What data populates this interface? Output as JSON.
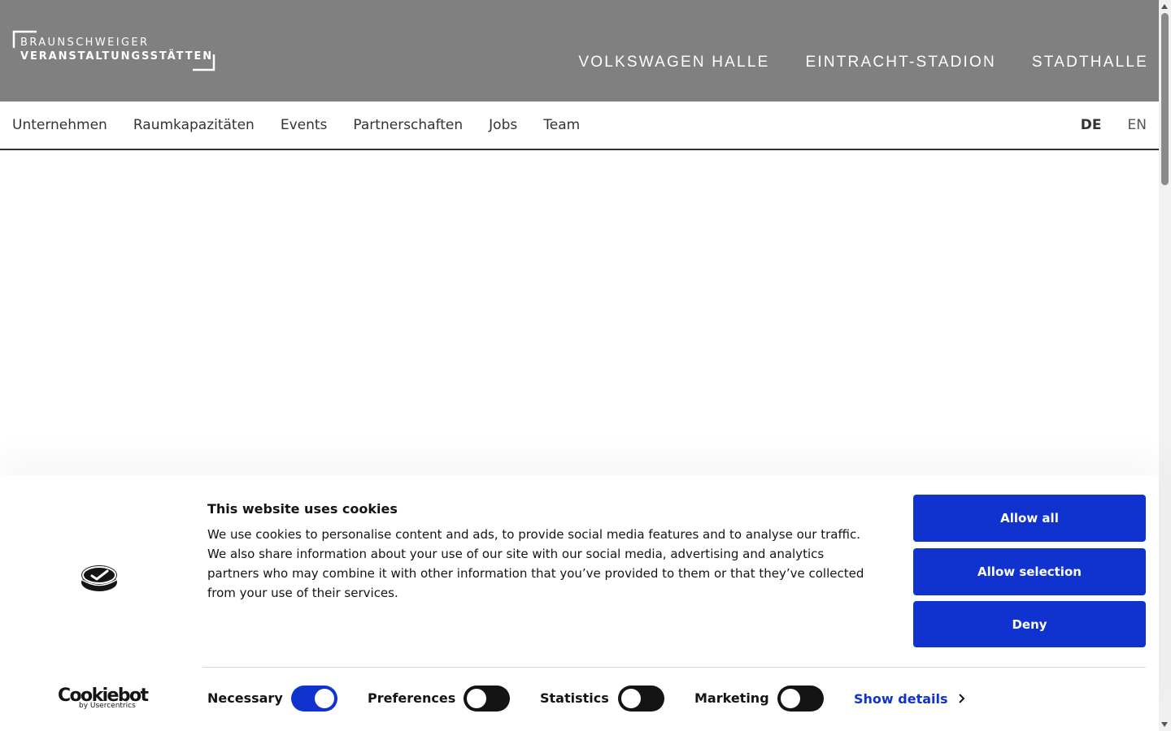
{
  "header": {
    "logo_line1": "BRAUNSCHWEIGER",
    "logo_line2": "VERANSTALTUNGSSTÄTTEN",
    "venues": [
      "VOLKSWAGEN HALLE",
      "EINTRACHT-STADION",
      "STADTHALLE"
    ],
    "background": "#808080"
  },
  "nav": {
    "items": [
      "Unternehmen",
      "Raumkapazitäten",
      "Events",
      "Partnerschaften",
      "Jobs",
      "Team"
    ],
    "languages": [
      "DE",
      "EN"
    ],
    "active_language": "DE"
  },
  "cookie_banner": {
    "title": "This website uses cookies",
    "text": "We use cookies to personalise content and ads, to provide social media features and to analyse our traffic. We also share information about your use of our site with our social media, advertising and analytics partners who may combine it with other information that you’ve provided to them or that they’ve collected from your use of their services.",
    "brand": "Cookiebot",
    "brand_by": "by Usercentrics",
    "buttons": {
      "allow_all": "Allow all",
      "allow_selection": "Allow selection",
      "deny": "Deny"
    },
    "consents": [
      {
        "label": "Necessary",
        "checked": true
      },
      {
        "label": "Preferences",
        "checked": false
      },
      {
        "label": "Statistics",
        "checked": false
      },
      {
        "label": "Marketing",
        "checked": false
      }
    ],
    "show_details": "Show details",
    "accent_color": "#1032cf"
  }
}
